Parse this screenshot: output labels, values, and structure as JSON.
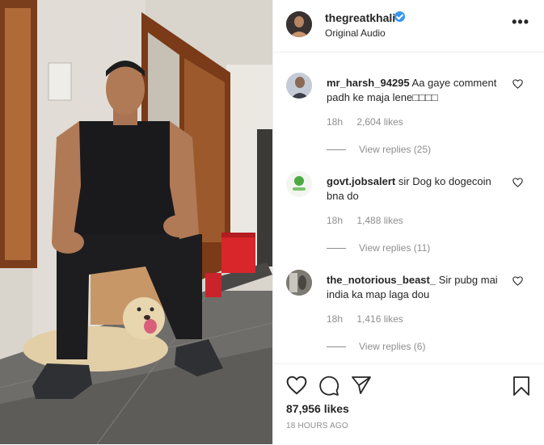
{
  "post": {
    "username": "thegreatkhali",
    "audio_label": "Original Audio",
    "likes_label": "87,956 likes",
    "timestamp": "18 HOURS AGO",
    "more_icon": "more-options-icon"
  },
  "comments": [
    {
      "username": "mr_harsh_94295",
      "text": "Aa gaye comment padh ke maja lene",
      "emoji": "□□□□",
      "age": "18h",
      "likes": "2,604 likes",
      "replies": "View replies (25)"
    },
    {
      "username": "govt.jobsalert",
      "text": "sir Dog ko dogecoin bna do",
      "emoji": "",
      "age": "18h",
      "likes": "1,488 likes",
      "replies": "View replies (11)"
    },
    {
      "username": "the_notorious_beast_",
      "text": "Sir pubg mai india ka map laga dou",
      "emoji": "",
      "age": "18h",
      "likes": "1,416 likes",
      "replies": "View replies (6)"
    }
  ],
  "colors": {
    "verified": "#3897f0",
    "text": "#262626",
    "muted": "#8e8e8e"
  }
}
